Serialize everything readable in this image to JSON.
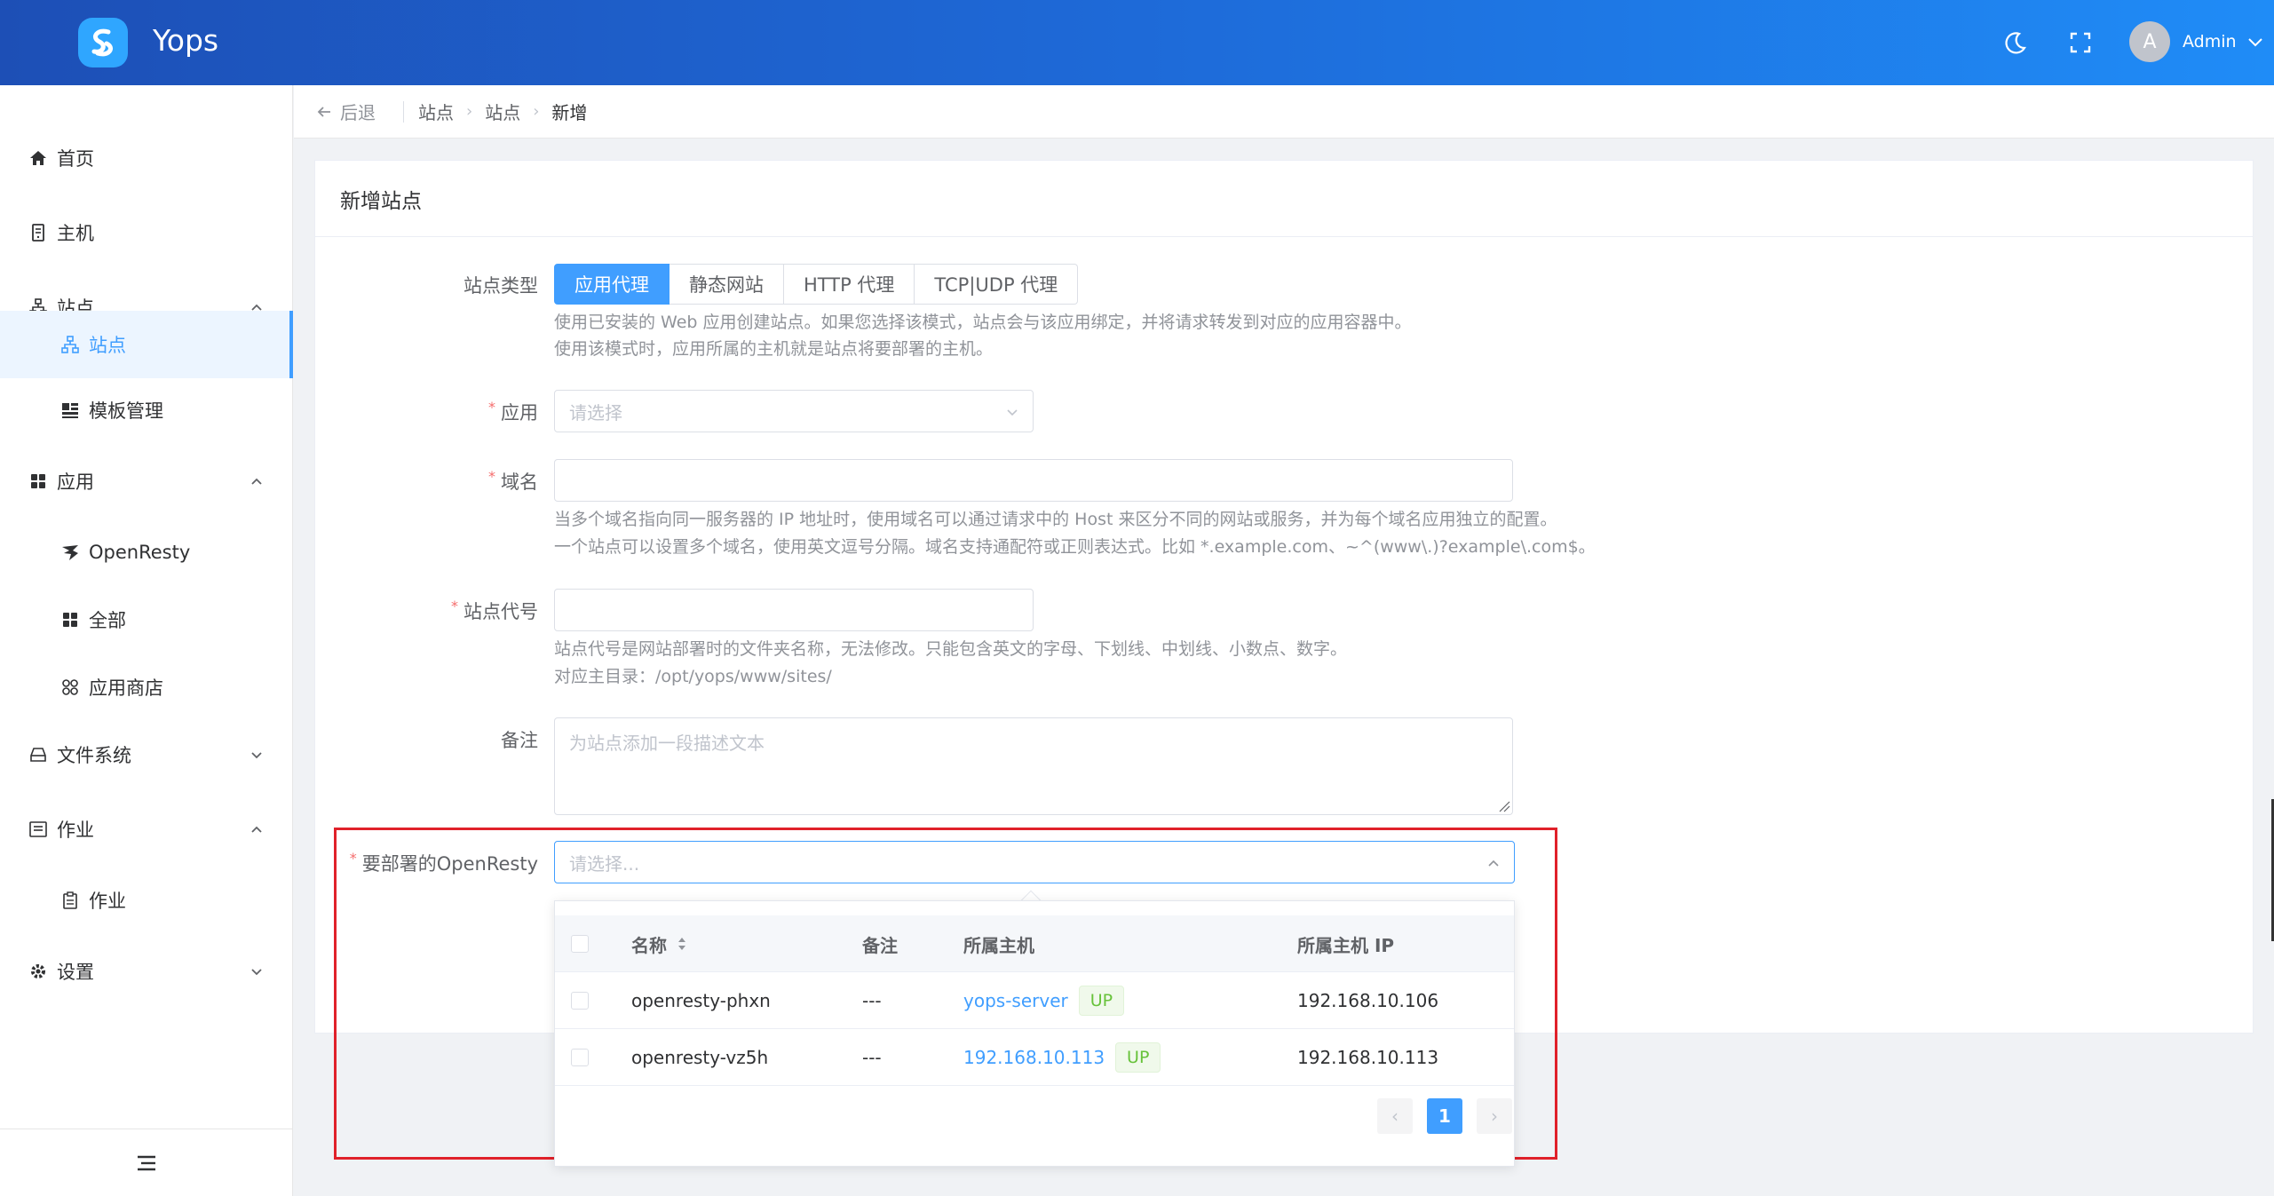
{
  "header": {
    "app_name": "Yops",
    "user_initial": "A",
    "user_name": "Admin",
    "icons": [
      "moon-icon",
      "fullscreen-icon",
      "chevron-down-icon"
    ]
  },
  "breadcrumb": {
    "back_label": "后退",
    "items": [
      "站点",
      "站点"
    ],
    "current": "新增"
  },
  "sidebar": {
    "items": [
      {
        "label": "首页",
        "icon": "home-icon"
      },
      {
        "label": "主机",
        "icon": "server-icon"
      },
      {
        "label": "站点",
        "icon": "sitemap-icon",
        "expanded": true
      },
      {
        "label": "站点",
        "icon": "sitemap-icon",
        "active": true
      },
      {
        "label": "模板管理",
        "icon": "template-icon"
      },
      {
        "label": "应用",
        "icon": "apps-icon",
        "expanded": true
      },
      {
        "label": "OpenResty",
        "icon": "openresty-icon"
      },
      {
        "label": "全部",
        "icon": "apps-icon"
      },
      {
        "label": "应用商店",
        "icon": "store-icon"
      },
      {
        "label": "文件系统",
        "icon": "disk-icon",
        "expanded": false
      },
      {
        "label": "作业",
        "icon": "job-icon",
        "expanded": true
      },
      {
        "label": "作业",
        "icon": "clipboard-icon"
      },
      {
        "label": "设置",
        "icon": "gear-icon",
        "expanded": false
      }
    ]
  },
  "card": {
    "title": "新增站点"
  },
  "form": {
    "site_type": {
      "label": "站点类型",
      "options": [
        "应用代理",
        "静态网站",
        "HTTP 代理",
        "TCP|UDP 代理"
      ],
      "selected": "应用代理",
      "hint_line1": "使用已安装的 Web 应用创建站点。如果您选择该模式，站点会与该应用绑定，并将请求转发到对应的应用容器中。",
      "hint_line2": "使用该模式时，应用所属的主机就是站点将要部署的主机。"
    },
    "app": {
      "label": "应用",
      "placeholder": "请选择"
    },
    "domain": {
      "label": "域名",
      "value": "",
      "hint_line1": "当多个域名指向同一服务器的 IP 地址时，使用域名可以通过请求中的 Host 来区分不同的网站或服务，并为每个域名应用独立的配置。",
      "hint_line2": "一个站点可以设置多个域名，使用英文逗号分隔。域名支持通配符或正则表达式。比如 *.example.com、~^(www\\.)?example\\.com$。"
    },
    "site_code": {
      "label": "站点代号",
      "value": "",
      "hint_line1": "站点代号是网站部署时的文件夹名称，无法修改。只能包含英文的字母、下划线、中划线、小数点、数字。",
      "hint_line2": "对应主目录：/opt/yops/www/sites/"
    },
    "remark": {
      "label": "备注",
      "placeholder": "为站点添加一段描述文本"
    },
    "openresty": {
      "label": "要部署的OpenResty",
      "placeholder": "请选择..."
    }
  },
  "dropdown_table": {
    "columns": [
      "名称",
      "备注",
      "所属主机",
      "所属主机 IP"
    ],
    "rows": [
      {
        "name": "openresty-phxn",
        "remark": "---",
        "host": "yops-server",
        "status": "UP",
        "ip": "192.168.10.106"
      },
      {
        "name": "openresty-vz5h",
        "remark": "---",
        "host": "192.168.10.113",
        "status": "UP",
        "ip": "192.168.10.113"
      }
    ],
    "pagination": {
      "current_page": "1",
      "prev": "‹",
      "next": "›"
    }
  },
  "colors": {
    "primary": "#409eff",
    "header_gradient_start": "#1d4fb6",
    "header_gradient_end": "#1f8cf7",
    "success": "#67c23a",
    "highlight_red": "#e0212a"
  }
}
